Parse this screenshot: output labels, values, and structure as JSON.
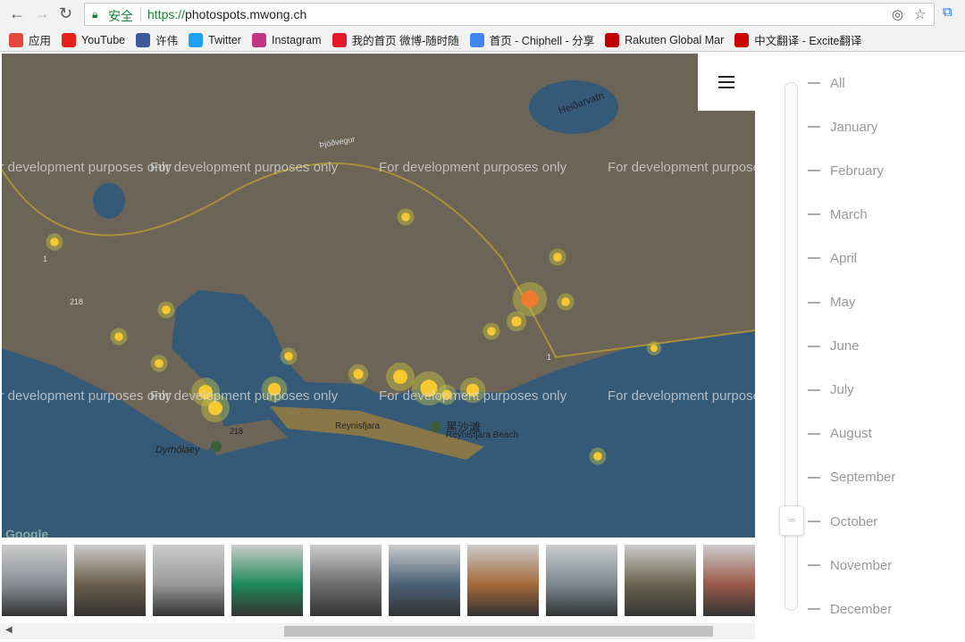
{
  "browser": {
    "security_label": "安全",
    "url_scheme": "https://",
    "url_host": "photospots.mwong.ch",
    "bookmarks": [
      {
        "label": "应用",
        "icon": "apps-grid-icon",
        "color": "#e8453c"
      },
      {
        "label": "YouTube",
        "icon": "youtube-icon",
        "color": "#e62117"
      },
      {
        "label": "许伟",
        "icon": "facebook-icon",
        "color": "#3b5998"
      },
      {
        "label": "Twitter",
        "icon": "twitter-icon",
        "color": "#1da1f2"
      },
      {
        "label": "Instagram",
        "icon": "instagram-icon",
        "color": "#c13584"
      },
      {
        "label": "我的首页 微博-随时随",
        "icon": "weibo-icon",
        "color": "#e6162d"
      },
      {
        "label": "首页 - Chiphell - 分享",
        "icon": "google-icon",
        "color": "#4285f4"
      },
      {
        "label": "Rakuten Global Mar",
        "icon": "rakuten-icon",
        "color": "#bf0000"
      },
      {
        "label": "中文翻译 - Excite翻译",
        "icon": "excite-icon",
        "color": "#c00"
      }
    ]
  },
  "map": {
    "watermark": "For development purposes only",
    "labels": {
      "lake": "Heiðarvatn",
      "road": "Þjóðvegur",
      "r1a": "1",
      "r1b": "1",
      "r218a": "218",
      "r218b": "218",
      "dyr": "Dyrhólaey",
      "rey": "Reynisfjara",
      "beach_cn": "黑沙滩",
      "beach": "Reynisfjara Beach",
      "google": "Google"
    }
  },
  "filter": {
    "selected": "October",
    "months": [
      "All",
      "January",
      "February",
      "March",
      "April",
      "May",
      "June",
      "July",
      "August",
      "September",
      "October",
      "November",
      "December"
    ]
  },
  "thumbnails": [
    "#8a8f95",
    "#6b5f4c",
    "#9a9a9a",
    "#1f8a5a",
    "#6e6e6e",
    "#4a6378",
    "#a56a3a",
    "#7d8a90",
    "#6a6550",
    "#9a5a4a"
  ]
}
